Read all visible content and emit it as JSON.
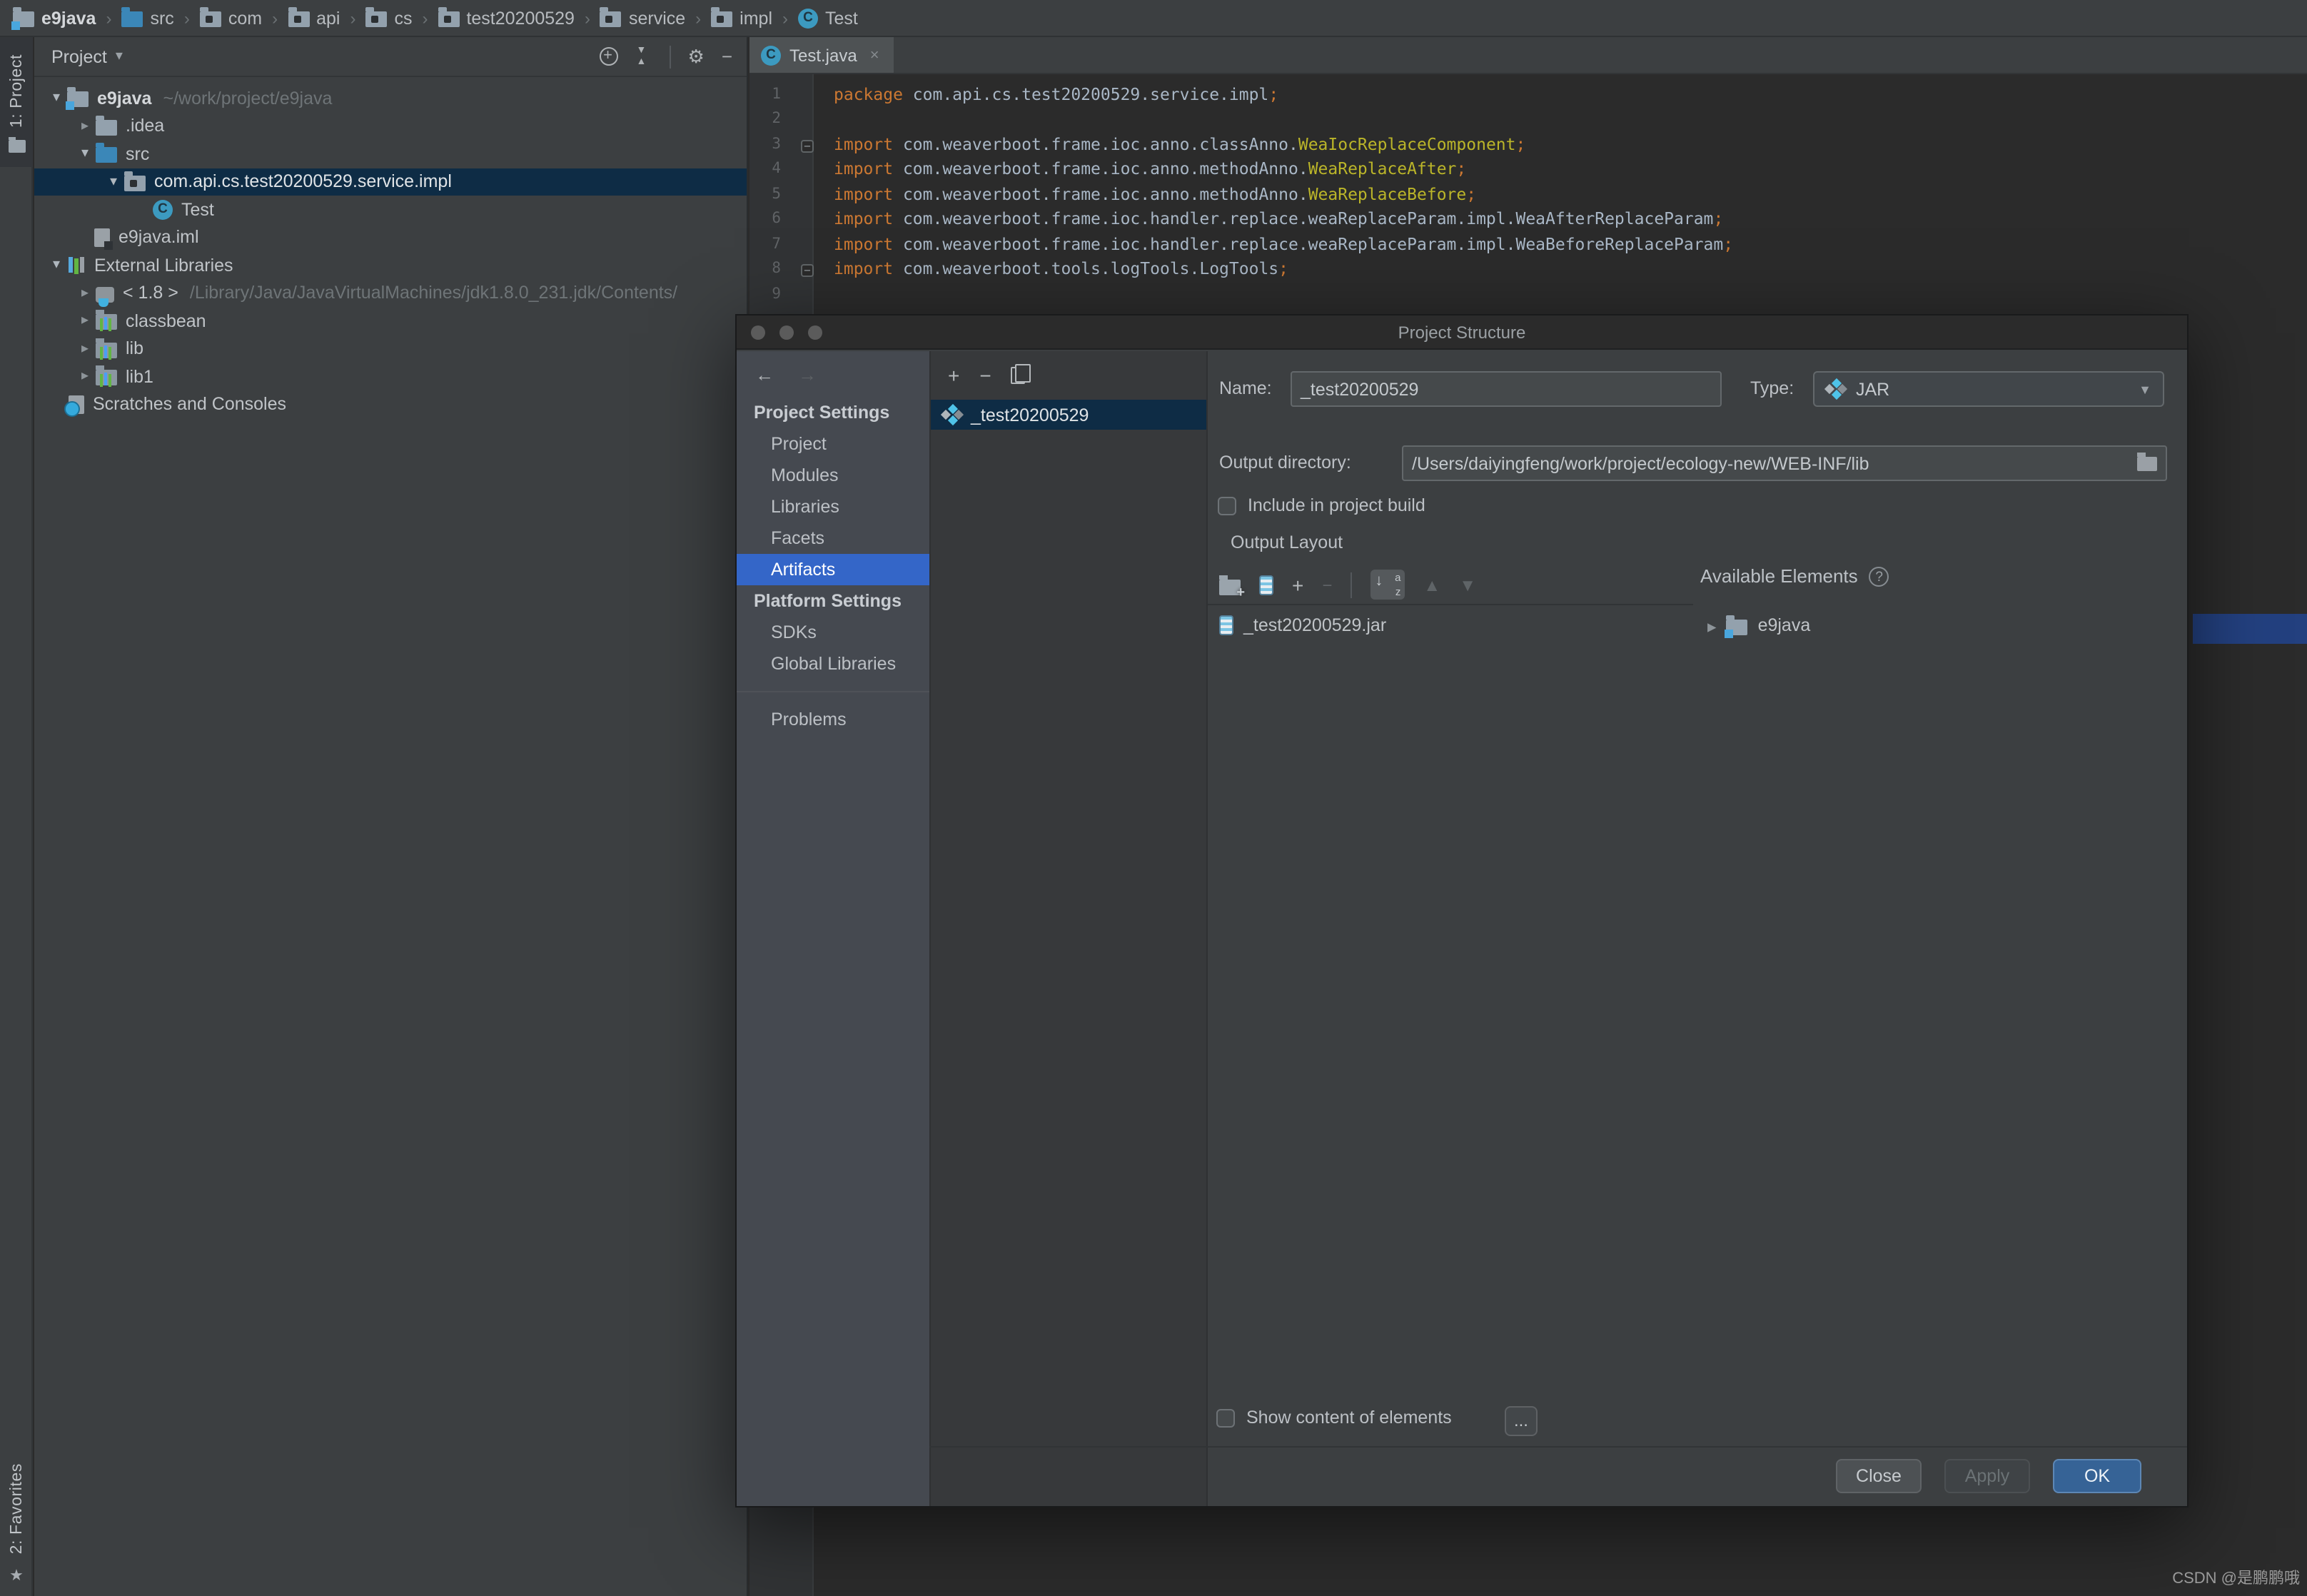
{
  "colors": {
    "accent_blue": "#3466c8",
    "selection_navy": "#0e2c45",
    "ok_button": "#366396",
    "editor_bg": "#2b2b2b",
    "panel_bg": "#3c3f41"
  },
  "breadcrumb": {
    "separator": "›",
    "items": [
      {
        "label": "e9java"
      },
      {
        "label": "src"
      },
      {
        "label": "com"
      },
      {
        "label": "api"
      },
      {
        "label": "cs"
      },
      {
        "label": "test20200529"
      },
      {
        "label": "service"
      },
      {
        "label": "impl"
      },
      {
        "label": "Test"
      }
    ]
  },
  "tool_windows": {
    "left_top": "1: Project",
    "left_bottom": "2: Favorites"
  },
  "project_panel": {
    "title": "Project",
    "tree": [
      {
        "label": "e9java",
        "hint": "~/work/project/e9java"
      },
      {
        "label": ".idea",
        "hint": ""
      },
      {
        "label": "src",
        "hint": ""
      },
      {
        "label": "com.api.cs.test20200529.service.impl",
        "hint": ""
      },
      {
        "label": "Test",
        "hint": ""
      },
      {
        "label": "e9java.iml",
        "hint": ""
      },
      {
        "label": "External Libraries",
        "hint": ""
      },
      {
        "label": "< 1.8 >",
        "hint": "/Library/Java/JavaVirtualMachines/jdk1.8.0_231.jdk/Contents/"
      },
      {
        "label": "classbean",
        "hint": ""
      },
      {
        "label": "lib",
        "hint": ""
      },
      {
        "label": "lib1",
        "hint": ""
      },
      {
        "label": "Scratches and Consoles",
        "hint": ""
      }
    ]
  },
  "editor": {
    "tab_label": "Test.java",
    "lines": [
      {
        "num": "1",
        "kw": "package",
        "a": " com.api.cs.test20200529.service.impl",
        "hl": "",
        "semi": ";"
      },
      {
        "num": "2",
        "kw": "",
        "a": "",
        "hl": "",
        "semi": ""
      },
      {
        "num": "3",
        "kw": "import",
        "a": " com.weaverboot.frame.ioc.anno.classAnno.",
        "hl": "WeaIocReplaceComponent",
        "semi": ";"
      },
      {
        "num": "4",
        "kw": "import",
        "a": " com.weaverboot.frame.ioc.anno.methodAnno.",
        "hl": "WeaReplaceAfter",
        "semi": ";"
      },
      {
        "num": "5",
        "kw": "import",
        "a": " com.weaverboot.frame.ioc.anno.methodAnno.",
        "hl": "WeaReplaceBefore",
        "semi": ";"
      },
      {
        "num": "6",
        "kw": "import",
        "a": " com.weaverboot.frame.ioc.handler.replace.weaReplaceParam.impl.WeaAfterReplaceParam",
        "hl": "",
        "semi": ";"
      },
      {
        "num": "7",
        "kw": "import",
        "a": " com.weaverboot.frame.ioc.handler.replace.weaReplaceParam.impl.WeaBeforeReplaceParam",
        "hl": "",
        "semi": ";"
      },
      {
        "num": "8",
        "kw": "import",
        "a": " com.weaverboot.tools.logTools.LogTools",
        "hl": "",
        "semi": ";"
      },
      {
        "num": "9",
        "kw": "",
        "a": "",
        "hl": "",
        "semi": ""
      }
    ]
  },
  "dialog": {
    "title": "Project Structure",
    "nav": {
      "sections": [
        {
          "header": "Project Settings",
          "items": [
            "Project",
            "Modules",
            "Libraries",
            "Facets",
            "Artifacts"
          ]
        },
        {
          "header": "Platform Settings",
          "items": [
            "SDKs",
            "Global Libraries"
          ]
        }
      ],
      "extra_item": "Problems",
      "selected": "Artifacts"
    },
    "artifact_list": {
      "items": [
        "_test20200529"
      ]
    },
    "form": {
      "name_label": "Name:",
      "name_value": "_test20200529",
      "type_label": "Type:",
      "type_value": "JAR",
      "output_dir_label": "Output directory:",
      "output_dir_value": "/Users/daiyingfeng/work/project/ecology-new/WEB-INF/lib",
      "include_label": "Include in project build",
      "layout_label": "Output Layout",
      "available_label": "Available Elements",
      "jar_item": "_test20200529.jar",
      "available_item": "e9java",
      "show_content_label": "Show content of elements",
      "more_label": "..."
    },
    "buttons": {
      "close": "Close",
      "apply": "Apply",
      "ok": "OK"
    }
  },
  "watermark": "CSDN @是鹏鹏哦"
}
